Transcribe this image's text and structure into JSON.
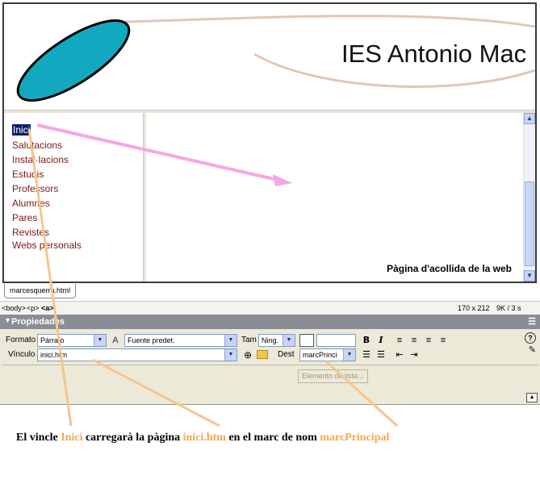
{
  "site": {
    "title": "IES Antonio Mac"
  },
  "nav": {
    "items": [
      "Inici",
      "Salutacions",
      "Instal·lacions",
      "Estudis",
      "Professors",
      "Alumnes",
      "Pares",
      "Revistes",
      "Webs personals"
    ],
    "selected": "Inici"
  },
  "main": {
    "welcome": "Pàgina d'acollida de la web"
  },
  "tab": {
    "label": "marcesquerra.html"
  },
  "tagbar": {
    "tag_body": "<body>",
    "tag_p": "<p>",
    "tag_a": "<a>",
    "size": "170 x 212",
    "weight": "9K / 3 s"
  },
  "properties": {
    "title": "Propiedades",
    "format_label": "Formato",
    "format_value": "Párrafo",
    "font_value": "Fuente predet.",
    "size_label": "Tam",
    "size_value": "Ning.",
    "link_label": "Vínculo",
    "link_value": "inici.htm",
    "target_label": "Dest",
    "target_value": "marcPrinci",
    "list_item_button": "Elemento de lista...",
    "help": "?"
  },
  "caption": {
    "part1": "El vincle ",
    "hl1": "Inici",
    "part2": " carregarà la pàgina ",
    "hl2": "inici.htm",
    "part3": " en el marc de nom ",
    "hl3": "marcPrincipal"
  },
  "colors": {
    "accent_orange": "#f7a84b",
    "pink_arrow": "#f6a6e4",
    "logo_teal": "#12a9c0",
    "link": "#7a1616"
  },
  "icons": {
    "bold": "B",
    "italic": "I",
    "font": "A"
  }
}
